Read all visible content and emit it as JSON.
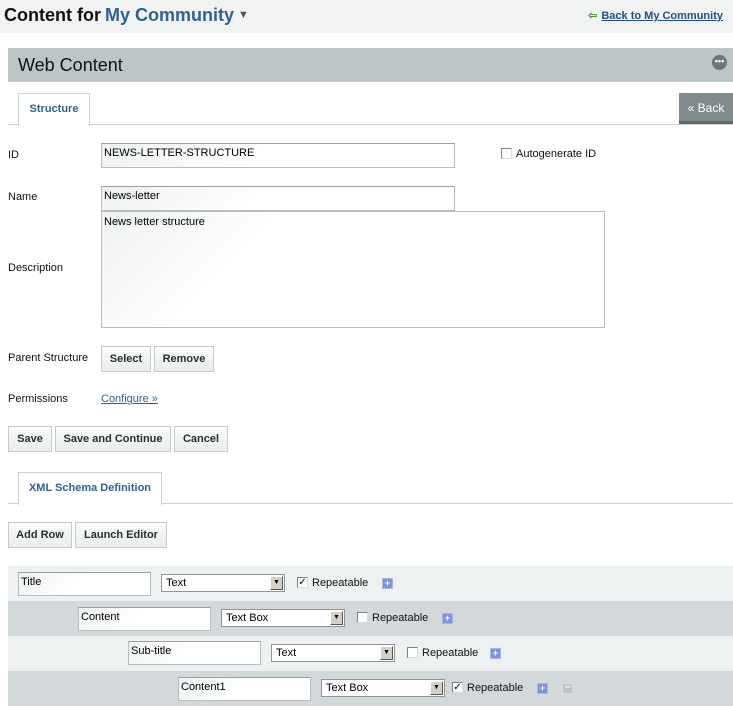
{
  "header": {
    "prefix": "Content for",
    "community": "My Community",
    "caret_icon": "▼",
    "back_link": "Back to My Community",
    "back_icon": "⇦"
  },
  "portlet": {
    "title": "Web Content",
    "options_icon": "•••"
  },
  "tabs": {
    "structure": "Structure",
    "xsd": "XML Schema Definition",
    "back_button": "« Back"
  },
  "form": {
    "id_label": "ID",
    "id_value": "NEWS-LETTER-STRUCTURE",
    "autogenerate_label": "Autogenerate ID",
    "autogenerate_checked": false,
    "name_label": "Name",
    "name_value": "News-letter",
    "description_label": "Description",
    "description_value": "News letter structure",
    "parent_label": "Parent Structure",
    "select_button": "Select",
    "remove_button": "Remove",
    "permissions_label": "Permissions",
    "configure_link": "Configure »",
    "save_button": "Save",
    "save_continue_button": "Save and Continue",
    "cancel_button": "Cancel"
  },
  "xsd": {
    "add_row_button": "Add Row",
    "launch_editor_button": "Launch Editor",
    "rows": [
      {
        "name": "Title",
        "type": "Text",
        "repeatable": true,
        "repeatable_label": "Repeatable",
        "check": "✓"
      },
      {
        "name": "Content",
        "type": "Text Box",
        "repeatable": false,
        "repeatable_label": "Repeatable",
        "check": ""
      },
      {
        "name": "Sub-title",
        "type": "Text",
        "repeatable": false,
        "repeatable_label": "Repeatable",
        "check": ""
      },
      {
        "name": "Content1",
        "type": "Text Box",
        "repeatable": true,
        "repeatable_label": "Repeatable",
        "check": "✓"
      }
    ],
    "plus_icon": "+",
    "minus_icon": "−",
    "dropdown_icon": "▼"
  }
}
